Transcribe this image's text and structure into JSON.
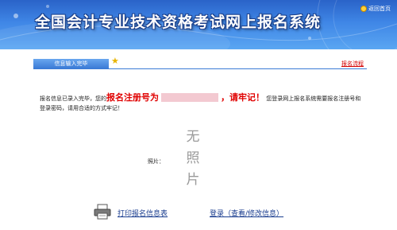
{
  "header": {
    "title": "全国会计专业技术资格考试网上报名系统",
    "home_link": "返回首页"
  },
  "steps": {
    "current_step": "信息输入完毕",
    "flow_link": "报名流程"
  },
  "message": {
    "part1": "报名信息已录入完毕，您的",
    "reg_label": "报名注册号为",
    "reg_remember": "，请牢记！",
    "part2": "您登录网上报名系统需要报名注册号和登录密码，请用合适的方式牢记！"
  },
  "photo": {
    "label": "照片：",
    "placeholder_chars": [
      "无",
      "照",
      "片"
    ]
  },
  "actions": {
    "print_label": "打印报名信息表",
    "login_label": "登录（查看/修改信息）"
  },
  "colors": {
    "banner": "#3f86e6",
    "accent_red": "#e00000",
    "link_blue": "#1a3d8f"
  },
  "icons": [
    "home-icon",
    "star-icon",
    "printer-icon"
  ]
}
